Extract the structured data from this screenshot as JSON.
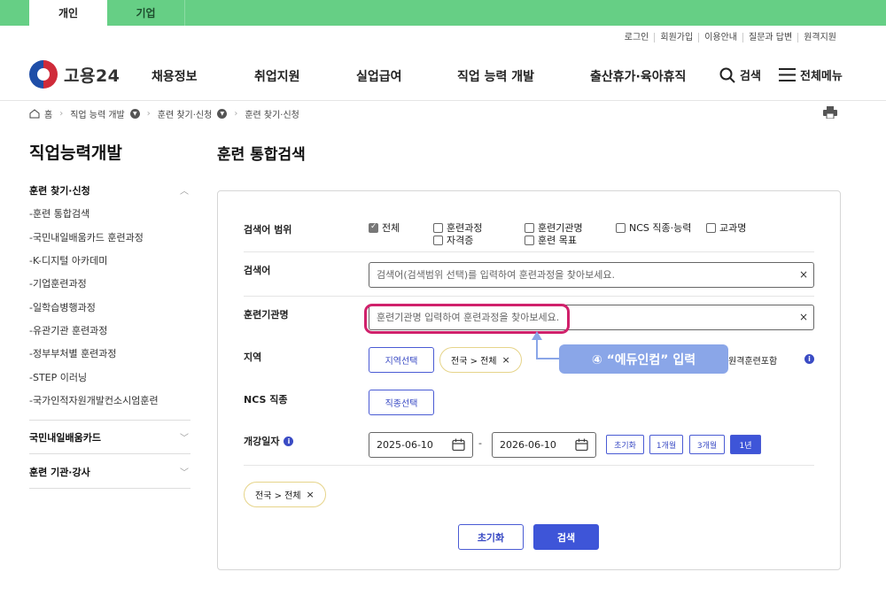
{
  "topbar": {
    "tabs": [
      "개인",
      "기업"
    ]
  },
  "util_links": [
    "로그인",
    "회원가입",
    "이용안내",
    "질문과 답변",
    "원격지원"
  ],
  "header": {
    "logo_text": "고용24",
    "nav": [
      "채용정보",
      "취업지원",
      "실업급여",
      "직업 능력 개발",
      "출산휴가·육아휴직"
    ],
    "search_label": "검색",
    "menu_label": "전체메뉴"
  },
  "breadcrumb": [
    "홈",
    "직업 능력 개발",
    "훈련 찾기·신청",
    "훈련 찾기·신청"
  ],
  "sidebar": {
    "title": "직업능력개발",
    "section1": "훈련 찾기·신청",
    "items": [
      "-훈련 통합검색",
      "-국민내일배움카드 훈련과정",
      "-K-디지털 아카데미",
      "-기업훈련과정",
      "-일학습병행과정",
      "-유관기관 훈련과정",
      "-정부부처별 훈련과정",
      "-STEP 이러닝",
      "-국가인적자원개발컨소시엄훈련"
    ],
    "section2": "국민내일배움카드",
    "section3": "훈련 기관·강사"
  },
  "main": {
    "title": "훈련 통합검색",
    "scope_label": "검색어 범위",
    "scope_options": [
      "전체",
      "훈련과정",
      "훈련기관명",
      "NCS 직종·능력",
      "교과명",
      "자격증",
      "훈련 목표"
    ],
    "keyword_label": "검색어",
    "keyword_placeholder": "검색어(검색범위 선택)를 입력하여 훈련과정을 찾아보세요.",
    "inst_label": "훈련기관명",
    "inst_placeholder": "훈련기관명 입력하여 훈련과정을 찾아보세요.",
    "region_label": "지역",
    "region_btn": "지역선택",
    "region_chip": "전국 > 전체",
    "remote_label": "원격훈련포함",
    "ncs_label": "NCS 직종",
    "ncs_btn": "직종선택",
    "date_label": "개강일자",
    "date_from": "2025-06-10",
    "date_to": "2026-06-10",
    "date_sep": "-",
    "period_btns": [
      "초기화",
      "1개월",
      "3개월",
      "1년"
    ],
    "selected_chip": "전국 > 전체",
    "reset_btn": "초기화",
    "search_btn": "검색",
    "clear_glyph": "×"
  },
  "callout": {
    "text": "④ “에듀인컴” 입력"
  }
}
